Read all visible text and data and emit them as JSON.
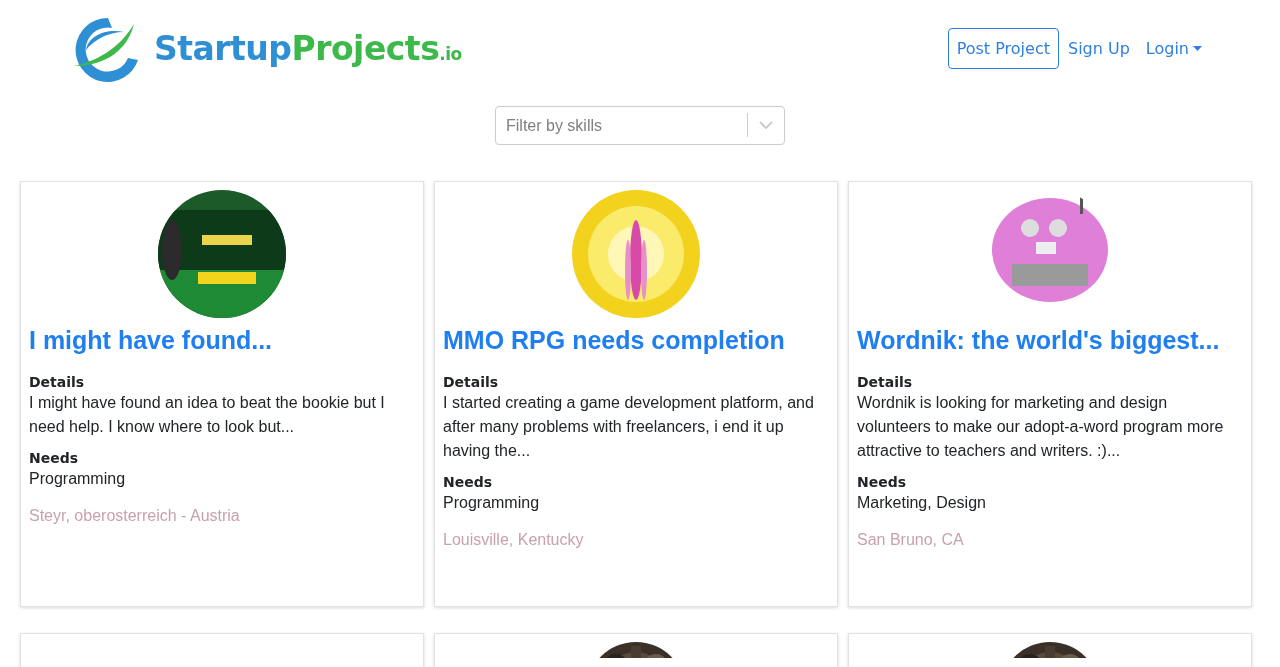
{
  "logo": {
    "first": "Startup",
    "second": "Projects",
    "suffix": ".io"
  },
  "nav": [
    {
      "label": "Post Project",
      "kind": "outline"
    },
    {
      "label": "Sign Up",
      "kind": "link"
    },
    {
      "label": "Login",
      "kind": "dropdown"
    }
  ],
  "filter": {
    "placeholder": "Filter by skills"
  },
  "projects": [
    {
      "title": "I might have found...",
      "details_label": "Details",
      "details": "I might have found an idea to beat the bookie but I need help. I know where to look but...",
      "needs_label": "Needs",
      "needs": "Programming",
      "location": "Steyr, oberosterreich - Austria"
    },
    {
      "title": "MMO RPG needs completion",
      "details_label": "Details",
      "details": "I started creating a game development platform, and after many problems with freelancers, i end it up having the...",
      "needs_label": "Needs",
      "needs": "Programming",
      "location": "Louisville, Kentucky"
    },
    {
      "title": "Wordnik: the world's biggest...",
      "details_label": "Details",
      "details": "Wordnik is looking for marketing and design volunteers to make our adopt-a-word program more attractive to teachers and writers. :)...",
      "needs_label": "Needs",
      "needs": "Marketing, Design",
      "location": "San Bruno, CA"
    }
  ],
  "more_projects": [
    {
      "avatar": false
    },
    {
      "avatar": true
    },
    {
      "avatar": true
    }
  ]
}
